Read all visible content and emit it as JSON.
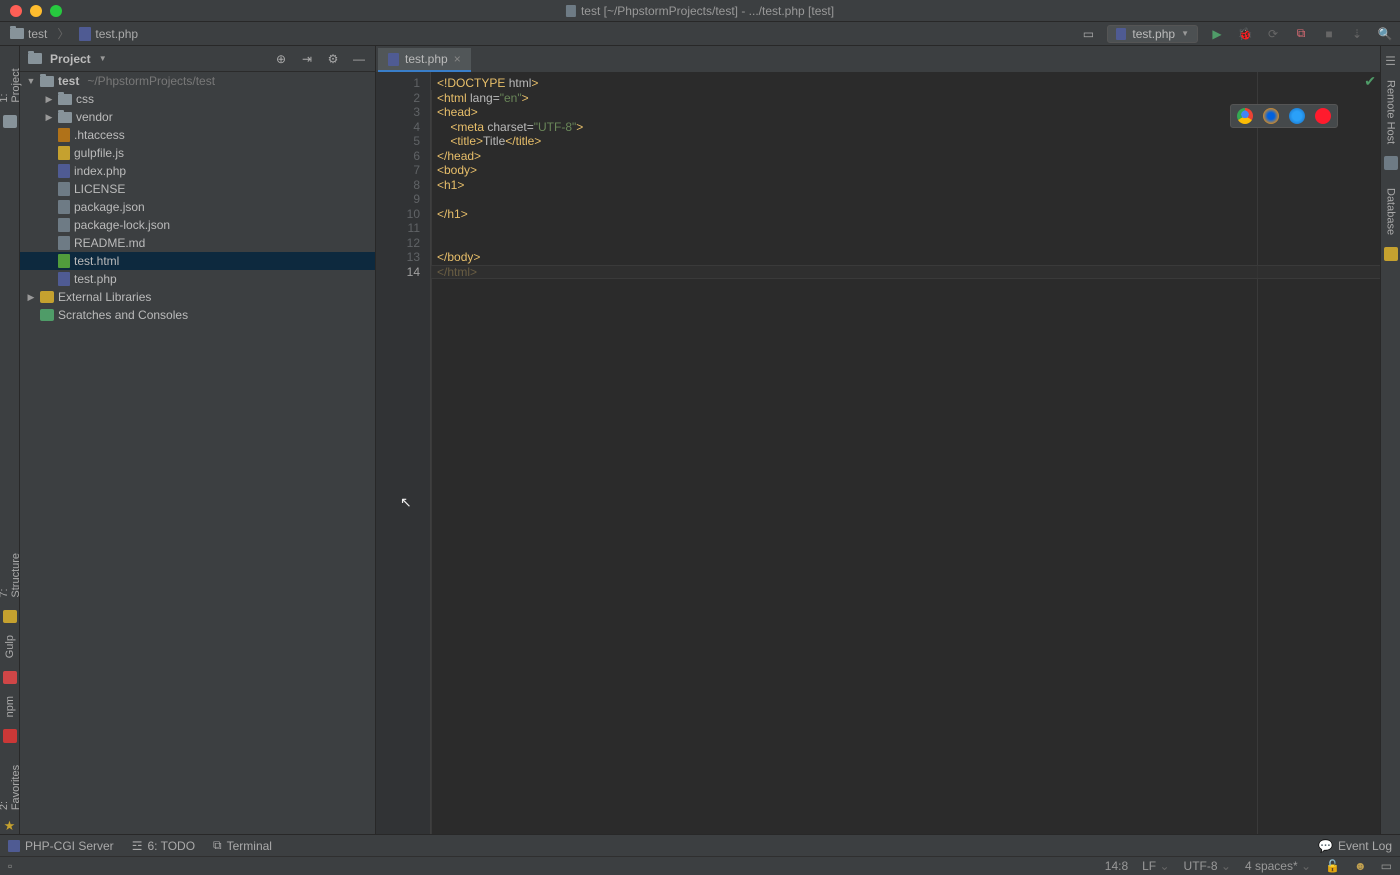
{
  "titlebar": {
    "title": "test [~/PhpstormProjects/test] - .../test.php [test]"
  },
  "breadcrumb": {
    "project": "test",
    "file": "test.php"
  },
  "run": {
    "config": "test.php"
  },
  "projectPanel": {
    "title": "Project",
    "root": {
      "name": "test",
      "path": "~/PhpstormProjects/test"
    },
    "folders": [
      {
        "name": "css"
      },
      {
        "name": "vendor"
      }
    ],
    "files": [
      {
        "name": ".htaccess",
        "type": "hta"
      },
      {
        "name": "gulpfile.js",
        "type": "js"
      },
      {
        "name": "index.php",
        "type": "php"
      },
      {
        "name": "LICENSE",
        "type": "txt"
      },
      {
        "name": "package.json",
        "type": "json"
      },
      {
        "name": "package-lock.json",
        "type": "json"
      },
      {
        "name": "README.md",
        "type": "txt"
      },
      {
        "name": "test.html",
        "type": "html",
        "selected": true
      },
      {
        "name": "test.php",
        "type": "php"
      }
    ],
    "external": "External Libraries",
    "scratches": "Scratches and Consoles"
  },
  "leftStripe": {
    "project": "1: Project",
    "structure": "7: Structure",
    "gulp": "Gulp",
    "npm": "npm",
    "favorites": "2: Favorites"
  },
  "rightStripe": {
    "remote": "Remote Host",
    "database": "Database"
  },
  "editor": {
    "tab": "test.php",
    "lineCount": 14,
    "caretLine": 14,
    "lines": [
      [
        [
          "doct",
          "<!DOCTYPE "
        ],
        [
          "attr",
          "html"
        ],
        [
          "doct",
          ">"
        ]
      ],
      [
        [
          "tag",
          "<html "
        ],
        [
          "attr",
          "lang="
        ],
        [
          "str",
          "\"en\""
        ],
        [
          "tag",
          ">"
        ]
      ],
      [
        [
          "tag",
          "<head>"
        ]
      ],
      [
        [
          "txt",
          "    "
        ],
        [
          "tag",
          "<meta "
        ],
        [
          "attr",
          "charset="
        ],
        [
          "str",
          "\"UTF-8\""
        ],
        [
          "tag",
          ">"
        ]
      ],
      [
        [
          "txt",
          "    "
        ],
        [
          "tag",
          "<title>"
        ],
        [
          "txt",
          "Title"
        ],
        [
          "tag",
          "</title>"
        ]
      ],
      [
        [
          "tag",
          "</head>"
        ]
      ],
      [
        [
          "tag",
          "<body>"
        ]
      ],
      [
        [
          "tag",
          "<h1>"
        ]
      ],
      [],
      [
        [
          "tag",
          "</h1>"
        ]
      ],
      [],
      [],
      [
        [
          "tag",
          "</body>"
        ]
      ],
      [
        [
          "tag",
          "</html>"
        ]
      ]
    ]
  },
  "bottomTools": {
    "php": "PHP-CGI Server",
    "todo": "6: TODO",
    "terminal": "Terminal",
    "eventlog": "Event Log"
  },
  "status": {
    "pos": "14:8",
    "lf": "LF",
    "enc": "UTF-8",
    "indent": "4 spaces*"
  }
}
